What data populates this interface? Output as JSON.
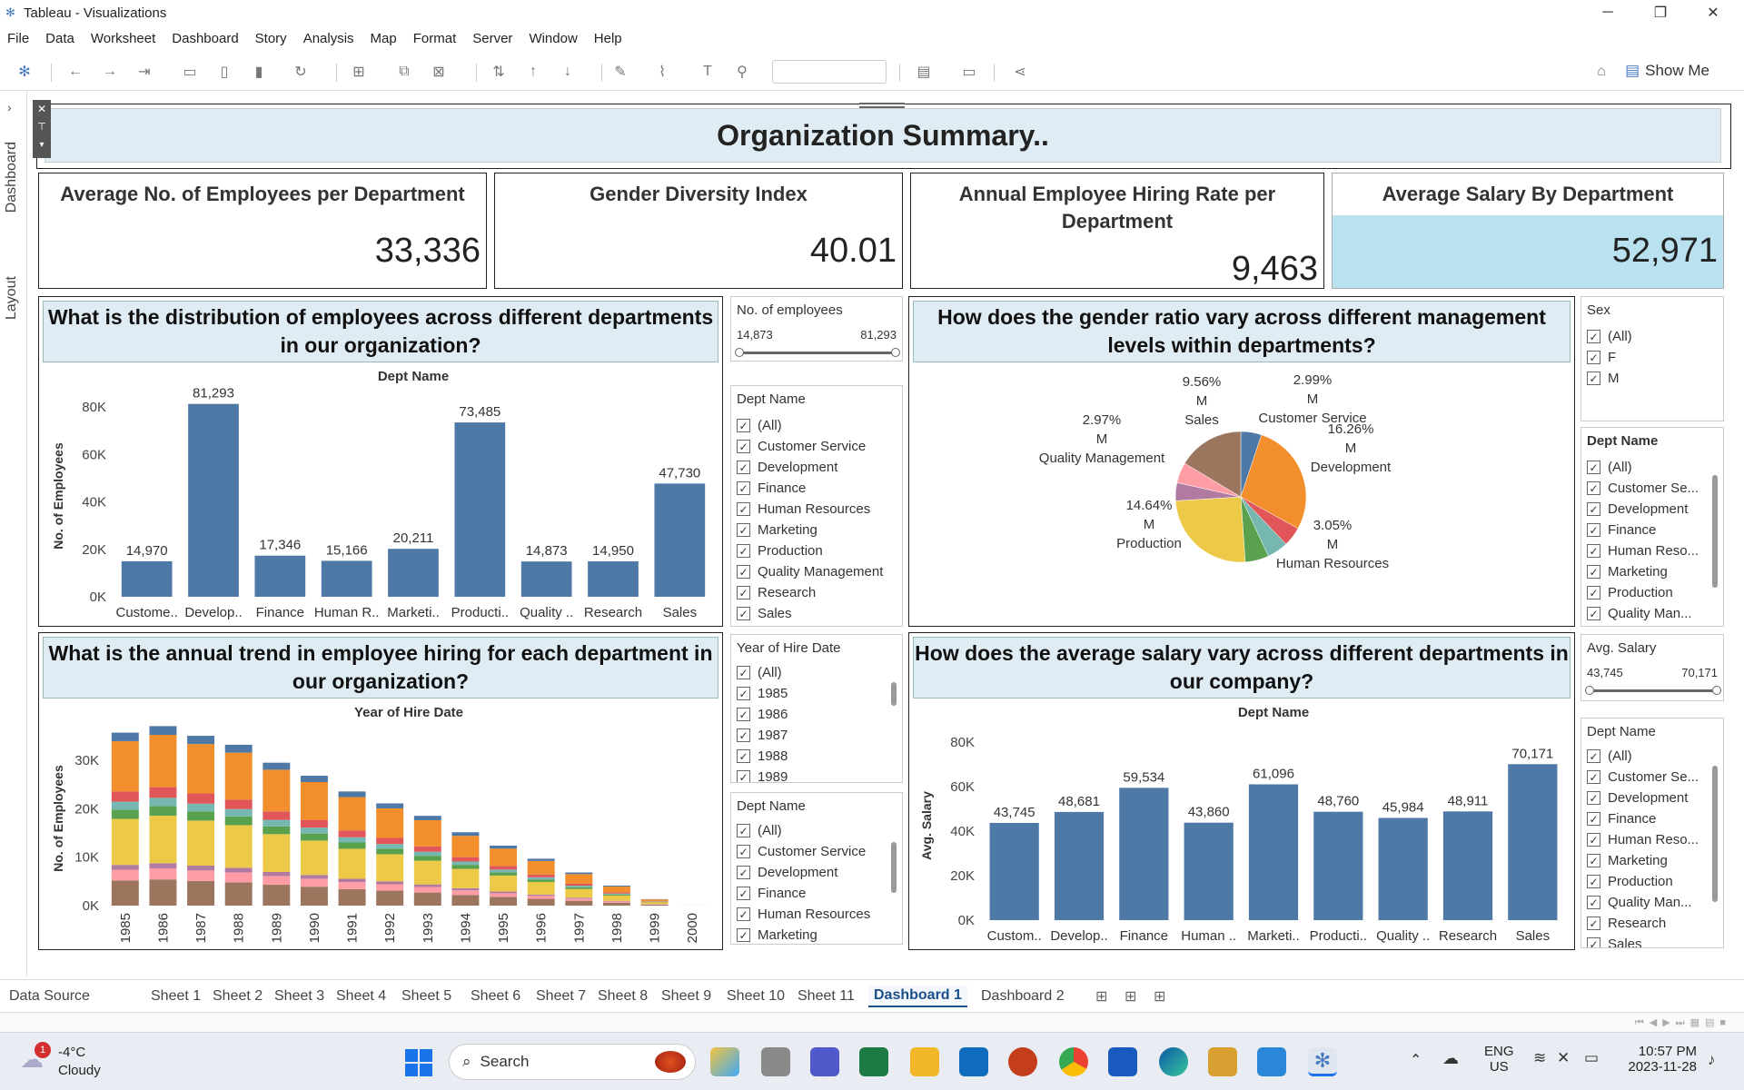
{
  "window": {
    "title": "Tableau - Visualizations"
  },
  "menu": [
    "File",
    "Data",
    "Worksheet",
    "Dashboard",
    "Story",
    "Analysis",
    "Map",
    "Format",
    "Server",
    "Window",
    "Help"
  ],
  "toolbar": {
    "show_me": "Show Me"
  },
  "side_tabs": {
    "dashboard": "Dashboard",
    "layout": "Layout"
  },
  "dashboard_title": "Organization Summary..",
  "kpis": [
    {
      "title": "Average No. of Employees per Department",
      "value": "33,336"
    },
    {
      "title": "Gender Diversity Index",
      "value": "40.01"
    },
    {
      "title": "Annual Employee Hiring Rate per Department",
      "value": "9,463"
    },
    {
      "title": "Average Salary By Department",
      "value": "52,971"
    }
  ],
  "questions": {
    "q1": "What is the distribution of employees across different departments in our organization?",
    "q2": "How does the gender ratio vary across different management levels within departments?",
    "q3": "What is the annual trend in employee hiring for each department in our organization?",
    "q4": "How does the average salary vary across different departments in our company?"
  },
  "filters": {
    "employees_range": {
      "title": "No. of employees",
      "min": "14,873",
      "max": "81,293"
    },
    "dept1": {
      "title": "Dept Name",
      "items": [
        "(All)",
        "Customer Service",
        "Development",
        "Finance",
        "Human Resources",
        "Marketing",
        "Production",
        "Quality Management",
        "Research",
        "Sales"
      ]
    },
    "year": {
      "title": "Year of Hire Date",
      "items": [
        "(All)",
        "1985",
        "1986",
        "1987",
        "1988",
        "1989"
      ]
    },
    "dept2": {
      "title": "Dept Name",
      "items": [
        "(All)",
        "Customer Service",
        "Development",
        "Finance",
        "Human Resources",
        "Marketing"
      ]
    },
    "sex": {
      "title": "Sex",
      "items": [
        "(All)",
        "F",
        "M"
      ]
    },
    "dept3": {
      "title": "Dept Name",
      "items": [
        "(All)",
        "Customer Se...",
        "Development",
        "Finance",
        "Human Reso...",
        "Marketing",
        "Production",
        "Quality Man..."
      ]
    },
    "salary_range": {
      "title": "Avg. Salary",
      "min": "43,745",
      "max": "70,171"
    },
    "dept4": {
      "title": "Dept Name",
      "items": [
        "(All)",
        "Customer Se...",
        "Development",
        "Finance",
        "Human Reso...",
        "Marketing",
        "Production",
        "Quality Man...",
        "Research",
        "Sales"
      ]
    }
  },
  "sheet_tabs": [
    "Data Source",
    "Sheet 1",
    "Sheet 2",
    "Sheet 3",
    "Sheet 4",
    "Sheet 5",
    "Sheet 6",
    "Sheet 7",
    "Sheet 8",
    "Sheet 9",
    "Sheet 10",
    "Sheet 11",
    "Dashboard 1",
    "Dashboard 2"
  ],
  "active_tab": "Dashboard 1",
  "taskbar": {
    "weather_temp": "-4°C",
    "weather_desc": "Cloudy",
    "weather_badge": "1",
    "search": "Search",
    "lang1": "ENG",
    "lang2": "US",
    "time": "10:57 PM",
    "date": "2023-11-28"
  },
  "colors": {
    "bar": "#4e79a7",
    "title_bg": "#e0ecf4",
    "kpi_highlight": "#b9e1ef"
  },
  "chart_data": [
    {
      "type": "bar",
      "title": "Dept Name",
      "ylabel": "No. of Employees",
      "categories": [
        "Custome..",
        "Develop..",
        "Finance",
        "Human R..",
        "Marketi..",
        "Producti..",
        "Quality ..",
        "Research",
        "Sales"
      ],
      "values": [
        14970,
        81293,
        17346,
        15166,
        20211,
        73485,
        14873,
        14950,
        47730
      ],
      "labels": [
        "14,970",
        "81,293",
        "17,346",
        "15,166",
        "20,211",
        "73,485",
        "14,873",
        "14,950",
        "47,730"
      ],
      "yticks": [
        "0K",
        "20K",
        "40K",
        "60K",
        "80K"
      ],
      "ylim": [
        0,
        85000
      ]
    },
    {
      "type": "pie",
      "slices": [
        {
          "label_pct": "2.99%",
          "label_sex": "M",
          "label_dept": "Customer Service",
          "value": 2.99,
          "color": "#4e79a7"
        },
        {
          "label_pct": "16.26%",
          "label_sex": "M",
          "label_dept": "Development",
          "value": 16.26,
          "color": "#f28e2b"
        },
        {
          "label_pct": "",
          "label_sex": "",
          "label_dept": "",
          "value": 2.8,
          "color": "#e15759"
        },
        {
          "label_pct": "3.05%",
          "label_sex": "M",
          "label_dept": "Human Resources",
          "value": 3.05,
          "color": "#76b7b2"
        },
        {
          "label_pct": "",
          "label_sex": "",
          "label_dept": "",
          "value": 3.4,
          "color": "#59a14f"
        },
        {
          "label_pct": "14.64%",
          "label_sex": "M",
          "label_dept": "Production",
          "value": 14.64,
          "color": "#edc948"
        },
        {
          "label_pct": "",
          "label_sex": "",
          "label_dept": "",
          "value": 2.6,
          "color": "#b07aa1"
        },
        {
          "label_pct": "2.97%",
          "label_sex": "M",
          "label_dept": "Quality Management",
          "value": 2.97,
          "color": "#ff9da7"
        },
        {
          "label_pct": "9.56%",
          "label_sex": "M",
          "label_dept": "Sales",
          "value": 9.56,
          "color": "#9c755f"
        }
      ]
    },
    {
      "type": "bar",
      "stacked": true,
      "title": "Year of Hire Date",
      "ylabel": "No. of Employees",
      "categories": [
        "1985",
        "1986",
        "1987",
        "1988",
        "1989",
        "1990",
        "1991",
        "1992",
        "1993",
        "1994",
        "1995",
        "1996",
        "1997",
        "1998",
        "1999",
        "2000"
      ],
      "yticks": [
        "0K",
        "10K",
        "20K",
        "30K"
      ],
      "ylim": [
        0,
        36000
      ],
      "series": [
        {
          "color": "#9c755f",
          "values": [
            5200,
            5400,
            5100,
            4800,
            4300,
            3900,
            3400,
            3100,
            2700,
            2200,
            1800,
            1400,
            1000,
            600,
            200,
            0
          ]
        },
        {
          "color": "#ff9da7",
          "values": [
            2200,
            2300,
            2150,
            2050,
            1800,
            1650,
            1450,
            1300,
            1150,
            950,
            750,
            600,
            430,
            260,
            90,
            0
          ]
        },
        {
          "color": "#b07aa1",
          "values": [
            1000,
            1050,
            1000,
            950,
            850,
            770,
            680,
            600,
            530,
            440,
            350,
            280,
            200,
            120,
            40,
            0
          ]
        },
        {
          "color": "#edc948",
          "values": [
            9500,
            9800,
            9300,
            8800,
            7800,
            7100,
            6200,
            5600,
            4900,
            4000,
            3300,
            2600,
            1800,
            1100,
            350,
            10
          ]
        },
        {
          "color": "#59a14f",
          "values": [
            1900,
            2000,
            1900,
            1800,
            1600,
            1450,
            1300,
            1150,
            1000,
            820,
            670,
            520,
            370,
            220,
            70,
            0
          ]
        },
        {
          "color": "#76b7b2",
          "values": [
            1650,
            1700,
            1600,
            1520,
            1350,
            1230,
            1080,
            970,
            850,
            690,
            570,
            440,
            310,
            190,
            60,
            0
          ]
        },
        {
          "color": "#e15759",
          "values": [
            2100,
            2200,
            2100,
            1950,
            1750,
            1600,
            1400,
            1250,
            1100,
            900,
            740,
            570,
            400,
            240,
            80,
            0
          ]
        },
        {
          "color": "#f28e2b",
          "values": [
            10400,
            10800,
            10200,
            9700,
            8600,
            7800,
            6900,
            6100,
            5400,
            4400,
            3600,
            2800,
            2000,
            1200,
            380,
            10
          ]
        },
        {
          "color": "#4e79a7",
          "values": [
            1750,
            1800,
            1700,
            1630,
            1450,
            1310,
            1150,
            1030,
            900,
            740,
            600,
            470,
            330,
            200,
            60,
            0
          ]
        }
      ]
    },
    {
      "type": "bar",
      "title": "Dept Name",
      "ylabel": "Avg. Salary",
      "categories": [
        "Custom..",
        "Develop..",
        "Finance",
        "Human ..",
        "Marketi..",
        "Producti..",
        "Quality ..",
        "Research",
        "Sales"
      ],
      "values": [
        43745,
        48681,
        59534,
        43860,
        61096,
        48760,
        45984,
        48911,
        70171
      ],
      "labels": [
        "43,745",
        "48,681",
        "59,534",
        "43,860",
        "61,096",
        "48,760",
        "45,984",
        "48,911",
        "70,171"
      ],
      "yticks": [
        "0K",
        "20K",
        "40K",
        "60K",
        "80K"
      ],
      "ylim": [
        0,
        85000
      ]
    }
  ]
}
